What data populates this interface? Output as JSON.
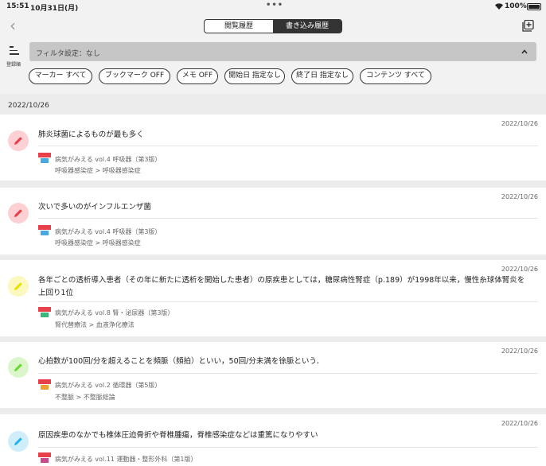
{
  "status": {
    "time": "15:51",
    "date": "10月31日(月)",
    "dots": "•••",
    "battery": "100%"
  },
  "nav": {
    "back": "‹",
    "tab_history": "閲覧履歴",
    "tab_written": "書き込み履歴"
  },
  "toolbar": {
    "list_label": "登録順",
    "filter_text": "フィルタ設定：なし"
  },
  "chips": [
    "マーカー すべて",
    "ブックマーク OFF",
    "メモ OFF",
    "開始日 指定なし",
    "終了日 指定なし",
    "コンテンツ すべて"
  ],
  "group_date": "2022/10/26",
  "colors": {
    "red": "#e8404a",
    "red_bg": "#fdd0d4",
    "yellow": "#e8e000",
    "yellow_bg": "#fcf8c0",
    "green": "#6ad834",
    "green_bg": "#dcf6cc",
    "blue": "#2ab2e6",
    "blue_bg": "#cfeefa"
  },
  "cards": [
    {
      "date": "2022/10/26",
      "marker": "red",
      "text": "肺炎球菌によるものが最も多く",
      "book": "病気がみえる vol.4 呼吸器（第3版）",
      "category": "呼吸器感染症 > 呼吸器感染症"
    },
    {
      "date": "2022/10/26",
      "marker": "red",
      "text": "次いで多いのがインフルエンザ菌",
      "book": "病気がみえる vol.4 呼吸器（第3版）",
      "category": "呼吸器感染症 > 呼吸器感染症"
    },
    {
      "date": "2022/10/26",
      "marker": "yellow",
      "text": "各年ごとの透析導入患者（その年に新たに透析を開始した患者）の原疾患としては，糖尿病性腎症（p.189）が1998年以来，慢性糸球体腎炎を上回り1位",
      "book": "病気がみえる vol.8 腎・泌尿器（第3版）",
      "category": "腎代替療法 > 血液浄化療法"
    },
    {
      "date": "2022/10/26",
      "marker": "green",
      "text": "心拍数が100回/分を超えることを頻脈（頻拍）といい，50回/分未満を徐脈という．",
      "book": "病気がみえる vol.2 循環器（第5版）",
      "category": "不整脈 > 不整脈総論"
    },
    {
      "date": "2022/10/26",
      "marker": "blue",
      "text": "原因疾患のなかでも椎体圧迫骨折や脊椎腫瘍，脊椎感染症などは重篤になりやすい",
      "book": "病気がみえる vol.11 運動器・整形外科（第1版）",
      "category": ""
    }
  ]
}
